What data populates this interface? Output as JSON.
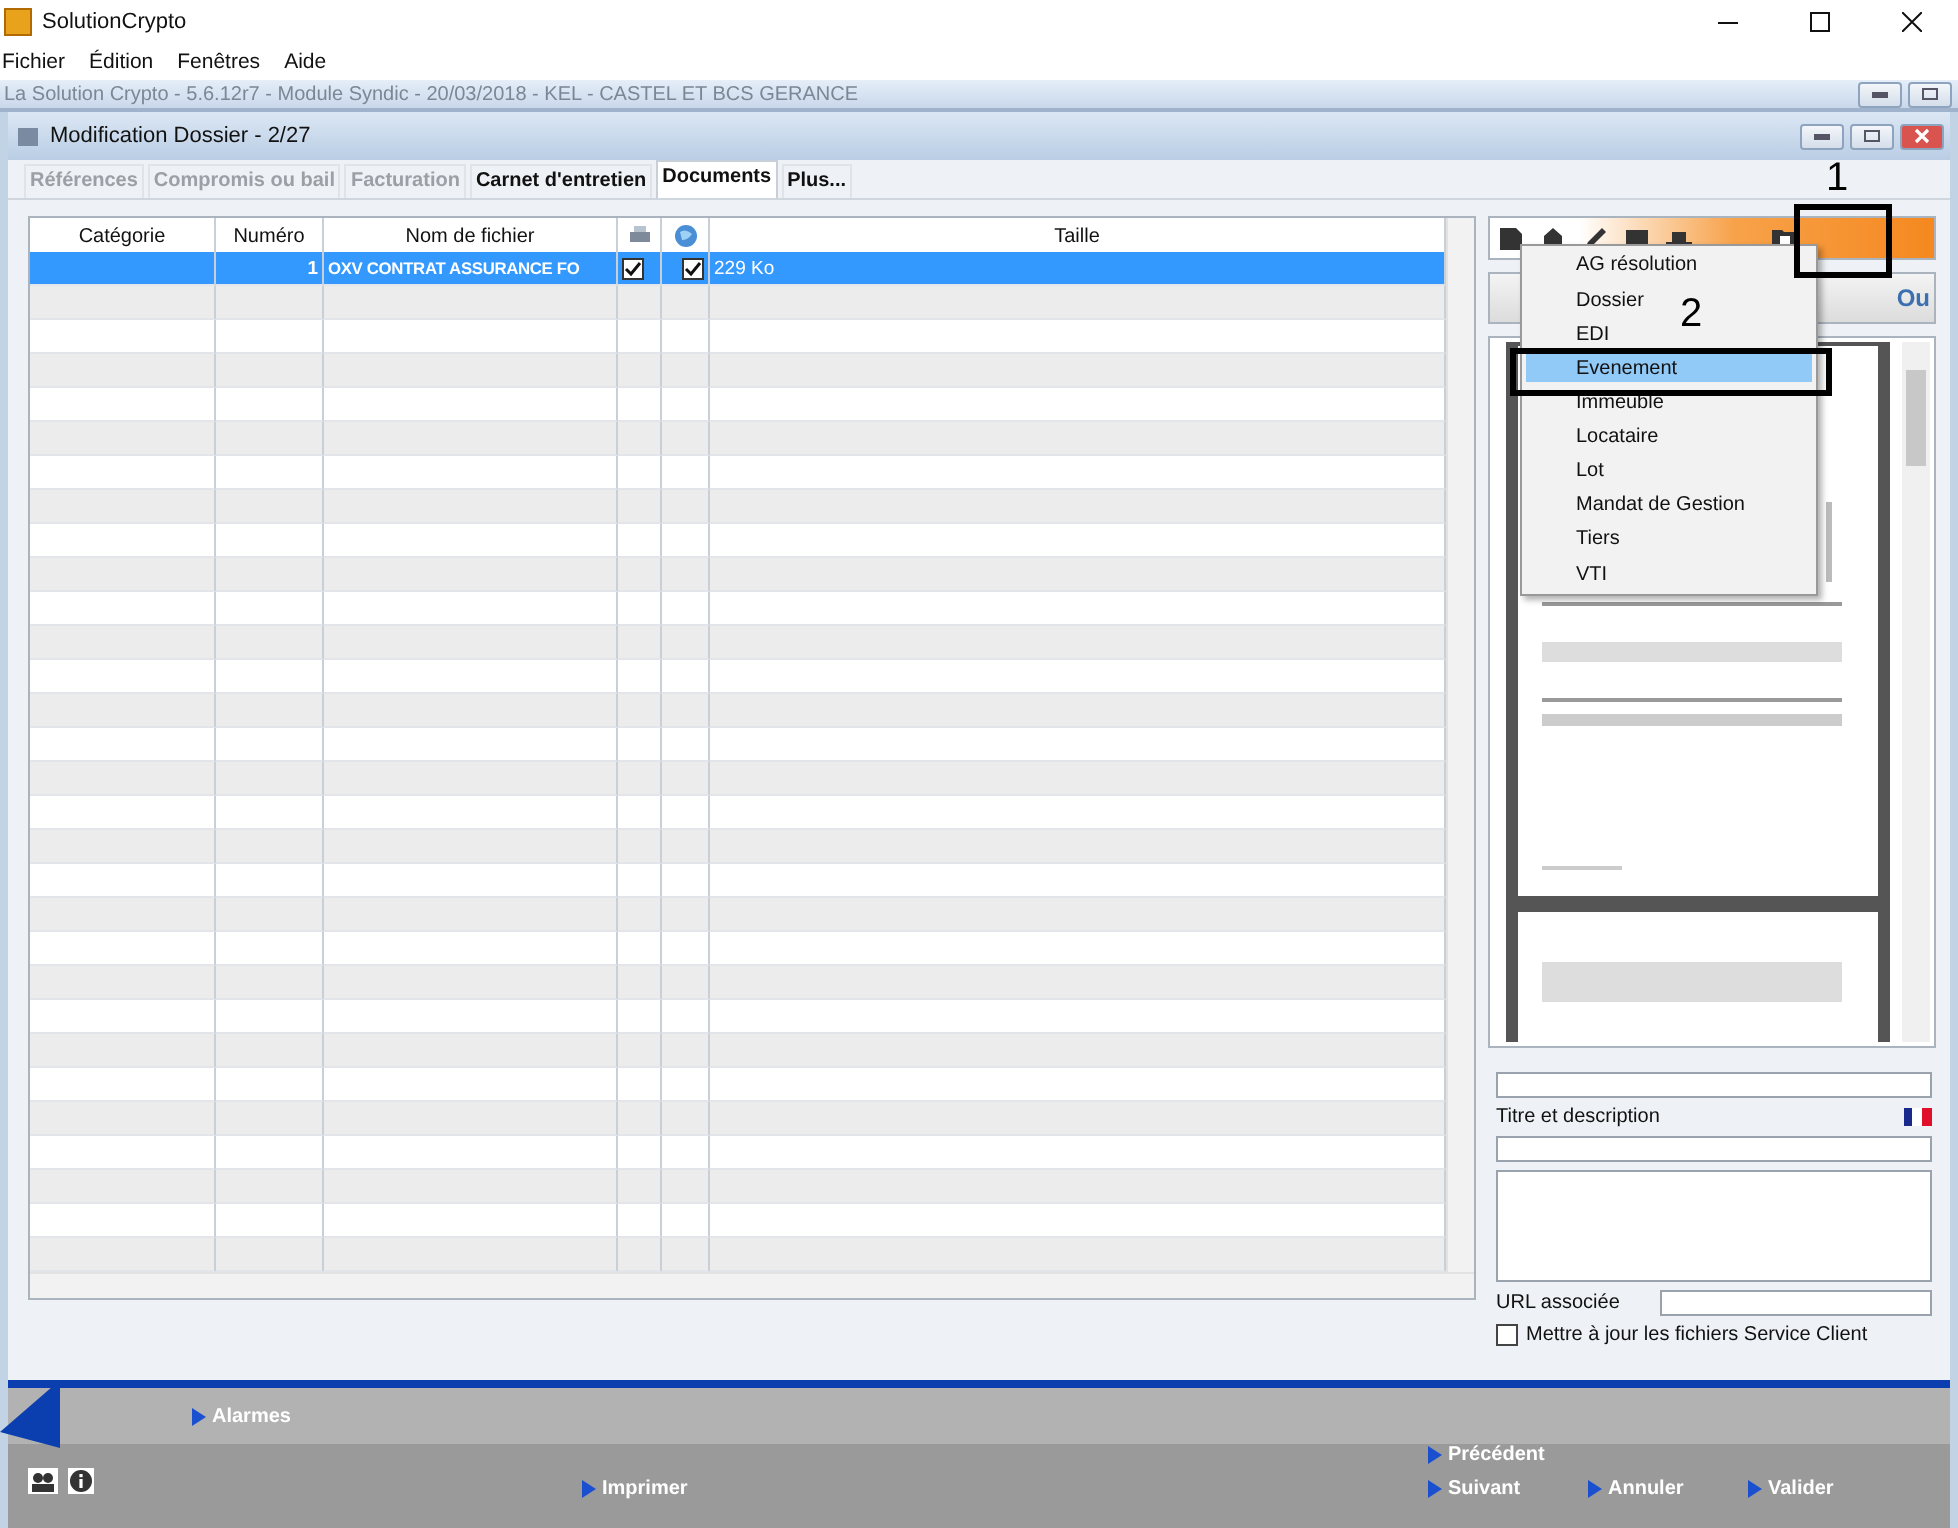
{
  "app": {
    "title": "SolutionCrypto",
    "menu": [
      "Fichier",
      "Édition",
      "Fenêtres",
      "Aide"
    ]
  },
  "mdi_title": "La Solution Crypto - 5.6.12r7 - Module Syndic - 20/03/2018 - KEL - CASTEL ET BCS GERANCE",
  "dialog": {
    "title": "Modification Dossier - 2/27"
  },
  "tabs": [
    {
      "label": "Références",
      "selected": false,
      "disabled": true
    },
    {
      "label": "Compromis ou bail",
      "selected": false,
      "disabled": true
    },
    {
      "label": "Facturation",
      "selected": false,
      "disabled": true
    },
    {
      "label": "Carnet d'entretien",
      "selected": false,
      "disabled": false
    },
    {
      "label": "Documents",
      "selected": true,
      "disabled": false
    },
    {
      "label": "Plus...",
      "selected": false,
      "disabled": false
    }
  ],
  "table": {
    "columns": [
      {
        "kind": "text",
        "label": "Catégorie"
      },
      {
        "kind": "text",
        "label": "Numéro"
      },
      {
        "kind": "text",
        "label": "Nom de fichier"
      },
      {
        "kind": "printer"
      },
      {
        "kind": "globe"
      },
      {
        "kind": "text",
        "label": "Taille"
      }
    ],
    "rows": [
      {
        "numero": "1",
        "nom": "OXV CONTRAT ASSURANCE FO",
        "print": true,
        "web": true,
        "taille": "229 Ko",
        "selected": true
      }
    ]
  },
  "preview": {
    "dropdown_text": "Ou"
  },
  "menu": [
    {
      "label": "AG résolution",
      "selected": false
    },
    {
      "label": "Dossier",
      "selected": false
    },
    {
      "label": "EDI",
      "selected": false
    },
    {
      "label": "Evenement",
      "selected": true
    },
    {
      "label": "Immeuble",
      "selected": false
    },
    {
      "label": "Locataire",
      "selected": false
    },
    {
      "label": "Lot",
      "selected": false
    },
    {
      "label": "Mandat de Gestion",
      "selected": false
    },
    {
      "label": "Tiers",
      "selected": false
    },
    {
      "label": "VTI",
      "selected": false
    }
  ],
  "annotations": [
    {
      "label": "1"
    },
    {
      "label": "2"
    }
  ],
  "form": {
    "title_label": "Titre et description",
    "url_label": "URL associée",
    "checkbox": {
      "label": "Mettre à jour les fichiers Service Client",
      "checked": false
    }
  },
  "bottom": {
    "alarmes": "Alarmes",
    "imprimer": "Imprimer",
    "precedent": "Précédent",
    "suivant": "Suivant",
    "annuler": "Annuler",
    "valider": "Valider"
  }
}
